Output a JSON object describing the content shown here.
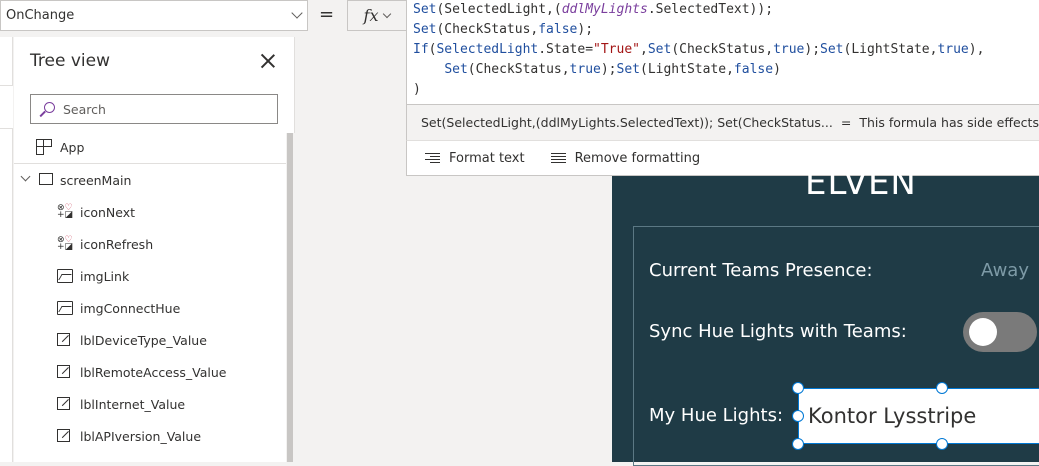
{
  "property_bar": {
    "selected_property": "OnChange",
    "equals": "=",
    "fx_label": "fx"
  },
  "formula": {
    "line1": [
      "Set",
      "(SelectedLight,(",
      "ddlMyLights",
      ".SelectedText));"
    ],
    "line2": [
      "Set",
      "(CheckStatus,",
      "false",
      ");"
    ],
    "line3": [
      "If",
      "(",
      "SelectedLight",
      ".State=",
      "\"True\"",
      ",",
      "Set",
      "(CheckStatus,",
      "true",
      ");",
      "Set",
      "(LightState,",
      "true",
      "),"
    ],
    "line4": [
      "Set",
      "(CheckStatus,",
      "true",
      ");",
      "Set",
      "(LightState,",
      "false",
      ")"
    ],
    "line5": ")"
  },
  "result_bar": {
    "expression": "Set(SelectedLight,(ddlMyLights.SelectedText)); Set(CheckStatus...",
    "equals": "=",
    "message": "This formula has side effects and cannot be evaluated."
  },
  "format_bar": {
    "format_text": "Format text",
    "remove_formatting": "Remove formatting"
  },
  "tree_view": {
    "title": "Tree view",
    "search_placeholder": "Search",
    "app_label": "App",
    "screen_label": "screenMain",
    "items": [
      {
        "label": "iconNext",
        "icon": "shapes-icon"
      },
      {
        "label": "iconRefresh",
        "icon": "shapes-icon"
      },
      {
        "label": "imgLink",
        "icon": "image-icon"
      },
      {
        "label": "imgConnectHue",
        "icon": "image-icon"
      },
      {
        "label": "lblDeviceType_Value",
        "icon": "label-icon"
      },
      {
        "label": "lblRemoteAccess_Value",
        "icon": "label-icon"
      },
      {
        "label": "lblInternet_Value",
        "icon": "label-icon"
      },
      {
        "label": "lblAPIversion_Value",
        "icon": "label-icon"
      }
    ]
  },
  "canvas": {
    "heading": "ELVEN",
    "presence_label": "Current Teams Presence:",
    "presence_value": "Away",
    "sync_label": "Sync Hue Lights with Teams:",
    "sync_on": false,
    "lights_label": "My Hue Lights:",
    "lights_selected": "Kontor Lysstripe",
    "colors": {
      "background": "#1f3b46",
      "accent": "#0078d4"
    }
  }
}
